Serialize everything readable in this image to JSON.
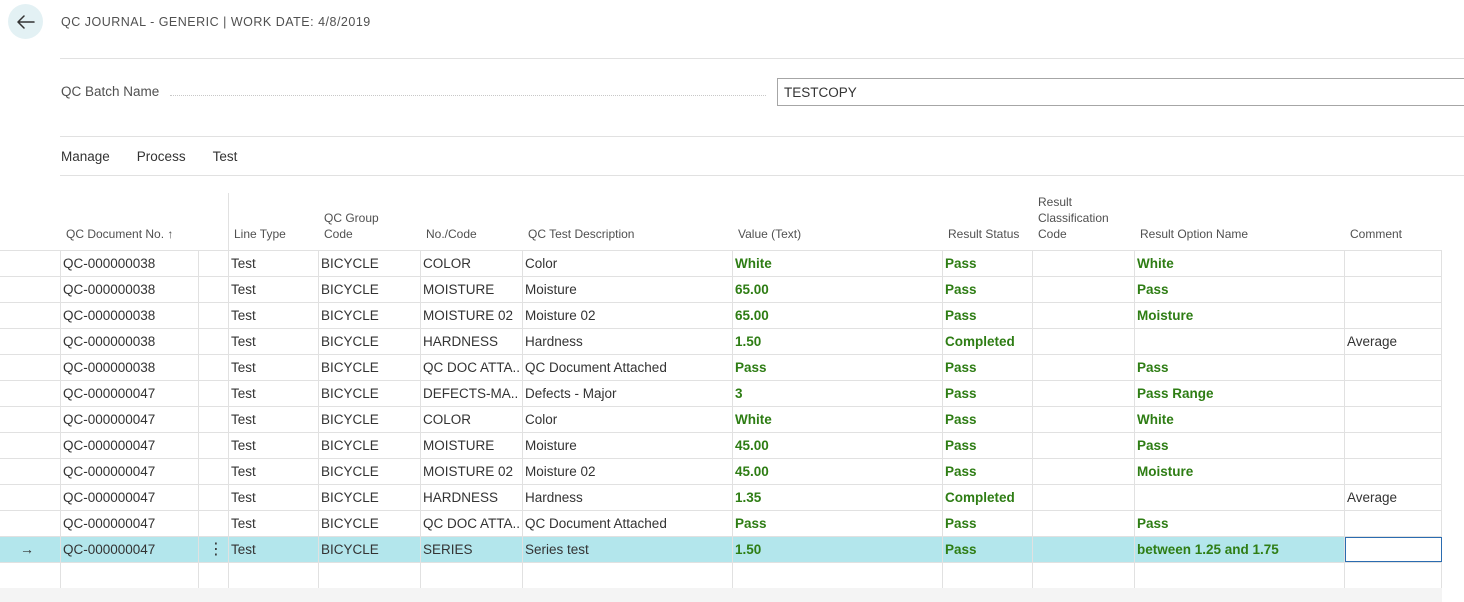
{
  "header": {
    "title": "QC JOURNAL - GENERIC | WORK DATE: 4/8/2019",
    "back_icon": "arrow-left-icon"
  },
  "batch": {
    "label": "QC Batch Name",
    "value": "TESTCOPY"
  },
  "actions": [
    "Manage",
    "Process",
    "Test"
  ],
  "columns": {
    "doc_no": "QC Document No. ↑",
    "line_type": "Line Type",
    "group_code": "QC Group Code",
    "no_code": "No./Code",
    "test_desc": "QC Test Description",
    "value_text": "Value (Text)",
    "result_status": "Result Status",
    "result_class": "Result Classification Code",
    "result_option": "Result Option Name",
    "comment": "Comment"
  },
  "rows": [
    {
      "doc": "QC-000000038",
      "type": "Test",
      "group": "BICYCLE",
      "code": "COLOR",
      "desc": "Color",
      "value": "White",
      "status": "Pass",
      "classification": "",
      "option": "White",
      "comment": ""
    },
    {
      "doc": "QC-000000038",
      "type": "Test",
      "group": "BICYCLE",
      "code": "MOISTURE",
      "desc": "Moisture",
      "value": "65.00",
      "status": "Pass",
      "classification": "",
      "option": "Pass",
      "comment": ""
    },
    {
      "doc": "QC-000000038",
      "type": "Test",
      "group": "BICYCLE",
      "code": "MOISTURE 02",
      "desc": "Moisture 02",
      "value": "65.00",
      "status": "Pass",
      "classification": "",
      "option": "Moisture",
      "comment": ""
    },
    {
      "doc": "QC-000000038",
      "type": "Test",
      "group": "BICYCLE",
      "code": "HARDNESS",
      "desc": "Hardness",
      "value": "1.50",
      "status": "Completed",
      "classification": "",
      "option": "",
      "comment": "Average"
    },
    {
      "doc": "QC-000000038",
      "type": "Test",
      "group": "BICYCLE",
      "code": "QC DOC ATTA...",
      "desc": "QC Document Attached",
      "value": "Pass",
      "status": "Pass",
      "classification": "",
      "option": "Pass",
      "comment": ""
    },
    {
      "doc": "QC-000000047",
      "type": "Test",
      "group": "BICYCLE",
      "code": "DEFECTS-MA...",
      "desc": "Defects - Major",
      "value": "3",
      "status": "Pass",
      "classification": "",
      "option": "Pass Range",
      "comment": ""
    },
    {
      "doc": "QC-000000047",
      "type": "Test",
      "group": "BICYCLE",
      "code": "COLOR",
      "desc": "Color",
      "value": "White",
      "status": "Pass",
      "classification": "",
      "option": "White",
      "comment": ""
    },
    {
      "doc": "QC-000000047",
      "type": "Test",
      "group": "BICYCLE",
      "code": "MOISTURE",
      "desc": "Moisture",
      "value": "45.00",
      "status": "Pass",
      "classification": "",
      "option": "Pass",
      "comment": ""
    },
    {
      "doc": "QC-000000047",
      "type": "Test",
      "group": "BICYCLE",
      "code": "MOISTURE 02",
      "desc": "Moisture 02",
      "value": "45.00",
      "status": "Pass",
      "classification": "",
      "option": "Moisture",
      "comment": ""
    },
    {
      "doc": "QC-000000047",
      "type": "Test",
      "group": "BICYCLE",
      "code": "HARDNESS",
      "desc": "Hardness",
      "value": "1.35",
      "status": "Completed",
      "classification": "",
      "option": "",
      "comment": "Average"
    },
    {
      "doc": "QC-000000047",
      "type": "Test",
      "group": "BICYCLE",
      "code": "QC DOC ATTA...",
      "desc": "QC Document Attached",
      "value": "Pass",
      "status": "Pass",
      "classification": "",
      "option": "Pass",
      "comment": ""
    },
    {
      "doc": "QC-000000047",
      "type": "Test",
      "group": "BICYCLE",
      "code": "SERIES",
      "desc": "Series test",
      "value": "1.50",
      "status": "Pass",
      "classification": "",
      "option": "between 1.25 and 1.75",
      "comment": "",
      "selected": true
    }
  ],
  "selected_row_icon": "arrow-right-icon",
  "row_menu_icon": "ellipsis-vertical-icon",
  "colors": {
    "accent_green": "#2e7d14",
    "selected_row": "#b3e6ec",
    "back_button_bg": "#e3f1f4"
  }
}
